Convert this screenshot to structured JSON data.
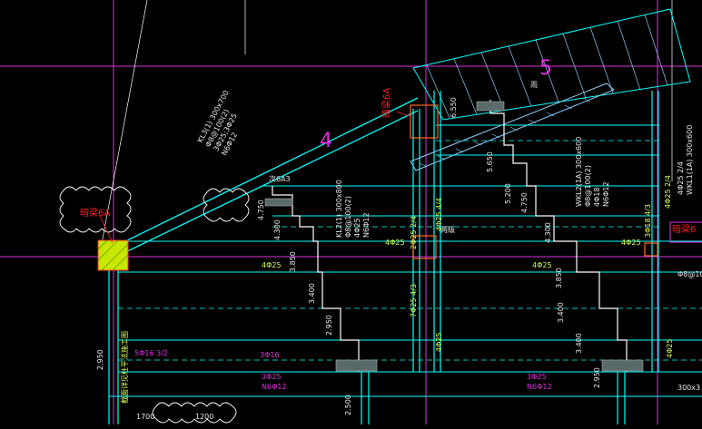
{
  "axis_markers": {
    "left": "4",
    "right": "5"
  },
  "callouts": {
    "hidden_beam_a": "暗梁6A",
    "hidden_beam_b": "暗梁6A",
    "secondary": "次6A3",
    "right_partial": "暗梁6"
  },
  "beam_notes": {
    "kl3": [
      "KL3(1) 300x700",
      "Φ8@100(2)",
      "3Φ25;3Φ25",
      "N6Φ12"
    ],
    "kl2": [
      "KL2(1) 300x800",
      "Φ8@100(2)",
      "4Φ25",
      "N6Φ12"
    ],
    "wkl2": [
      "WKL2(1A) 300x600",
      "Φ8@100(2)",
      "4Φ18",
      "N6Φ12"
    ],
    "wkl1": [
      "WKL1(1A) 300x600",
      "4Φ25 2/4"
    ]
  },
  "dimensions": {
    "d1": "4.750",
    "d2": "4.300",
    "d3": "3.850",
    "d4": "3.400",
    "d5": "2.950",
    "d6": "2.500",
    "d7": "5.650",
    "d8": "5.200",
    "d9": "4.750",
    "d10": "6.550",
    "d11": "1700",
    "d12": "1200",
    "d13": "2.950",
    "d14": "3.400",
    "d15": "3.850",
    "d16": "2.950",
    "d17": "3.400",
    "d18": "4.300"
  },
  "rebar_labels": {
    "r1": "5Φ16 3/2",
    "r2": "3Φ16",
    "r3": "3Φ25",
    "r4": "N6Φ12",
    "r5": "3Φ25",
    "r6": "N6Φ12",
    "r7": "4Φ25",
    "r8": "4Φ25",
    "r9": "4Φ25",
    "r10": "4Φ25",
    "r11": "7Φ25 4/3",
    "r12": "4Φ25",
    "r13": "3Φ18 4/3",
    "r14": "4Φ25",
    "r15": "300x3",
    "r16": "Φ8@100"
  },
  "vertical_notes": {
    "left_wall": "截面详见柱平法施工图",
    "mid_rebar": "4Φ25 4/4",
    "mid_rebar2": "2Φ25 2/4",
    "right_rebar": "4Φ25 2/4"
  },
  "step_note": "两级",
  "stair_note": "雨",
  "colors": {
    "background": "#000000",
    "cyan": "#00ffff",
    "white": "#ffffff",
    "magenta": "#e030e0",
    "red": "#ff2020",
    "yellow_green": "#c8e600",
    "green_text": "#d8ff50",
    "hatch": "#8fd0ff"
  }
}
